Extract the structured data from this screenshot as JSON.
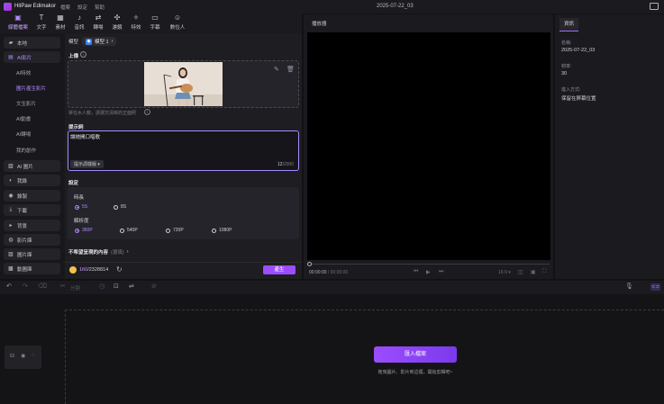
{
  "app": {
    "name": "HitPaw Edimakor",
    "project": "2025-07-22_03"
  },
  "menu": [
    "檔案",
    "設定",
    "幫助"
  ],
  "toolbar": [
    {
      "label": "媒體檔案",
      "icon": "media-icon",
      "active": true
    },
    {
      "label": "文字",
      "icon": "text-icon"
    },
    {
      "label": "素材",
      "icon": "assets-icon"
    },
    {
      "label": "音訊",
      "icon": "audio-icon"
    },
    {
      "label": "轉場",
      "icon": "transition-icon"
    },
    {
      "label": "濾鏡",
      "icon": "filter-icon"
    },
    {
      "label": "特效",
      "icon": "effects-icon"
    },
    {
      "label": "字幕",
      "icon": "subtitle-icon"
    },
    {
      "label": "數位人",
      "icon": "avatar-icon"
    }
  ],
  "sidebar": {
    "items": [
      {
        "label": "本地",
        "icon": "folder-icon"
      },
      {
        "label": "AI影片",
        "icon": "ai-video-icon",
        "selected": true
      },
      {
        "label": "AI 圖片",
        "icon": "ai-image-icon"
      },
      {
        "label": "我錄",
        "icon": "record-icon"
      },
      {
        "label": "錄製",
        "icon": "capture-icon"
      },
      {
        "label": "下載",
        "icon": "download-icon"
      },
      {
        "label": "背景",
        "icon": "background-icon"
      },
      {
        "label": "影片庫",
        "icon": "video-library-icon"
      },
      {
        "label": "圖片庫",
        "icon": "image-library-icon"
      },
      {
        "label": "動圖庫",
        "icon": "gif-library-icon"
      }
    ],
    "subitems": [
      {
        "label": "AI特效"
      },
      {
        "label": "圖片產生影片",
        "selected": true
      },
      {
        "label": "文生影片"
      },
      {
        "label": "AI動畫"
      },
      {
        "label": "AI轉場"
      },
      {
        "label": "我的創作"
      }
    ]
  },
  "generator": {
    "model_label": "模型",
    "model_value": "模型 1",
    "upload_label": "上傳",
    "upload_hint": "單在水人鏡，請選交清晰的正面照",
    "prompt_label": "提示詞",
    "prompt_value": "讓她開口唱歌",
    "prompt_tag": "提示詞樣版",
    "prompt_count": "12",
    "prompt_max": "/2000",
    "settings_label": "設定",
    "duration_label": "時長",
    "durations": [
      {
        "label": "5S",
        "on": true
      },
      {
        "label": "8S",
        "on": false
      }
    ],
    "resolution_label": "解析度",
    "resolutions": [
      {
        "label": "360P",
        "on": true
      },
      {
        "label": "540P",
        "on": false
      },
      {
        "label": "720P",
        "on": false
      },
      {
        "label": "1080P",
        "on": false
      }
    ],
    "negative_label": "不希望呈現的內容",
    "negative_hint": "(選填)",
    "credits_used": "160",
    "credits_total": "/2328814",
    "generate_label": "產生"
  },
  "player": {
    "title": "播放器",
    "time_current": "00:00:00",
    "time_total": "/ 00:00:00",
    "ratio": "16:9"
  },
  "info": {
    "tab": "資訊",
    "fields": [
      {
        "key": "名稱:",
        "value": "2025-07-22_03"
      },
      {
        "key": "幀率:",
        "value": "30"
      },
      {
        "key": "進入方式:",
        "value": "保留在屏幕位置"
      }
    ]
  },
  "timeline": {
    "split_label": "分割",
    "import_label": "匯入檔案",
    "import_hint": "拖曳圖片、影片到這裡，開始剪輯吧~"
  }
}
